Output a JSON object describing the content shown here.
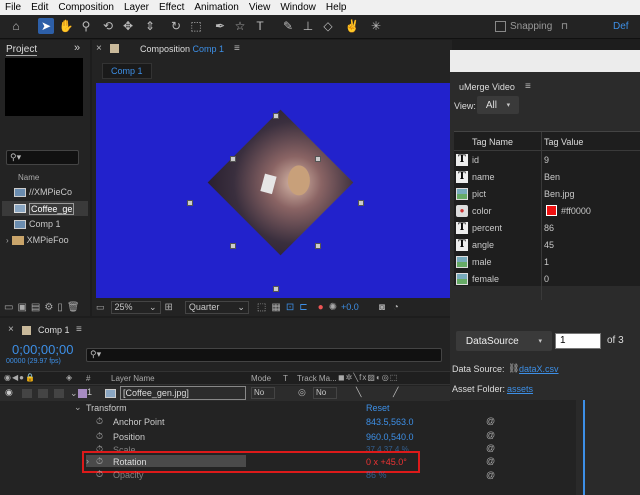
{
  "menu": [
    "File",
    "Edit",
    "Composition",
    "Layer",
    "Effect",
    "Animation",
    "View",
    "Window",
    "Help"
  ],
  "toolbar": {
    "snapping_label": "Snapping",
    "def_label": "Def"
  },
  "project": {
    "tab_label": "Project",
    "name_header": "Name",
    "items": [
      {
        "name": "//XMPieCo",
        "icon": "composition-icon"
      },
      {
        "name": "Coffee_ge",
        "icon": "image-icon"
      },
      {
        "name": "Comp 1",
        "icon": "composition-icon"
      },
      {
        "name": "XMPieFoo",
        "icon": "folder-icon"
      }
    ]
  },
  "composition": {
    "tab_prefix": "Composition",
    "tab_name": "Comp 1",
    "subtab": "Comp 1",
    "zoom": "25%",
    "resolution": "Quarter",
    "offset": "+0.0",
    "bg_color": "#2222cc"
  },
  "umerge": {
    "title": "uMerge Video",
    "view_label": "View:",
    "view_value": "All",
    "col_name": "Tag Name",
    "col_value": "Tag Value",
    "rows": [
      {
        "type": "T",
        "name": "id",
        "value": "9"
      },
      {
        "type": "T",
        "name": "name",
        "value": "Ben"
      },
      {
        "type": "img",
        "name": "pict",
        "value": "Ben.jpg"
      },
      {
        "type": "color",
        "name": "color",
        "value": "#ff0000",
        "swatch": "#ee1111"
      },
      {
        "type": "T",
        "name": "percent",
        "value": "86"
      },
      {
        "type": "T",
        "name": "angle",
        "value": "45"
      },
      {
        "type": "img",
        "name": "male",
        "value": "1"
      },
      {
        "type": "img",
        "name": "female",
        "value": "0"
      }
    ],
    "datasource_btn": "DataSource",
    "record_value": "1",
    "of_label": "of 3",
    "datasource_label": "Data Source:",
    "datasource_file": "dataX.csv",
    "assets_label": "Asset Folder:",
    "assets_link": "assets"
  },
  "timeline": {
    "tab_name": "Comp 1",
    "timecode": "0;00;00;00",
    "fps": "00000 (29.97 fps)",
    "col_num": "#",
    "col_layer": "Layer Name",
    "col_mode": "Mode",
    "col_t": "T",
    "col_trackmatte": "Track Ma...",
    "layer_num": "1",
    "layer_name": "[Coffee_gen.jpg]",
    "mode_value": "No",
    "trackmatte_value": "No",
    "transform_label": "Transform",
    "reset_label": "Reset",
    "properties": [
      {
        "name": "Anchor Point",
        "value": "843.5,563.0"
      },
      {
        "name": "Position",
        "value": "960.0,540.0"
      },
      {
        "name": "Scale",
        "value": "37.4,37.4 %"
      },
      {
        "name": "Rotation",
        "value": "0 x +45.0°"
      },
      {
        "name": "Opacity",
        "value": "86 %"
      }
    ]
  }
}
